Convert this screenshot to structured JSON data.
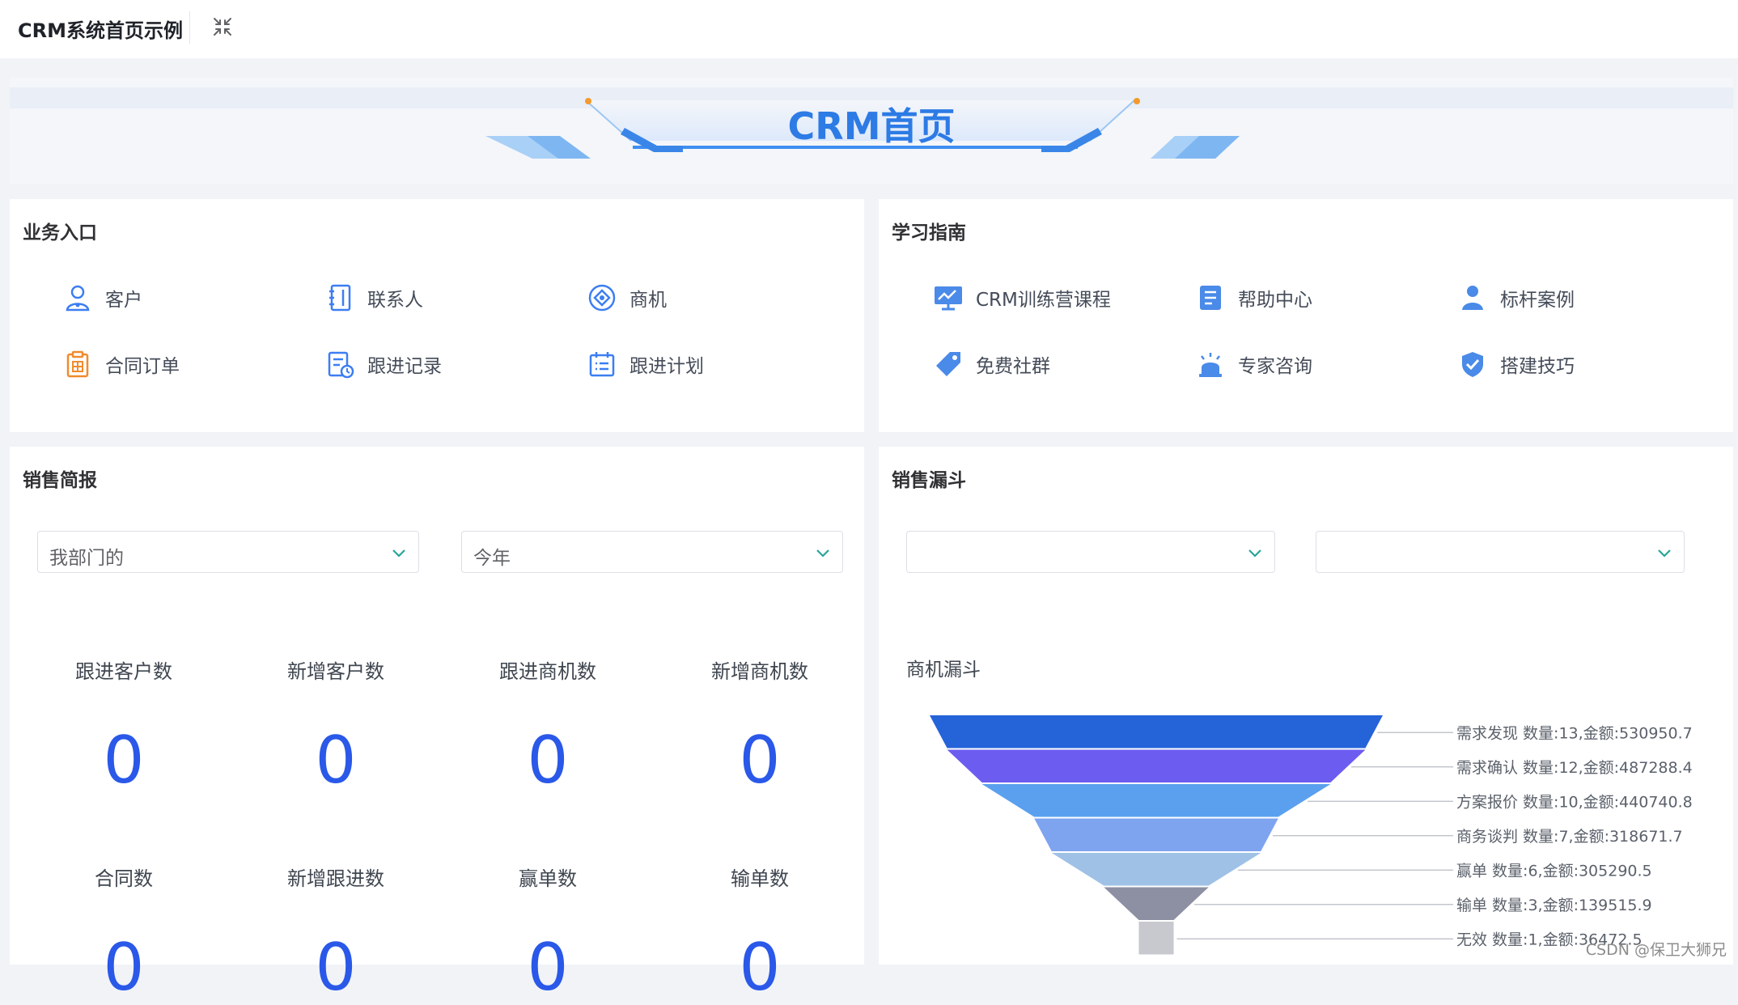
{
  "header": {
    "app_title": "CRM系统首页示例"
  },
  "banner": {
    "title": "CRM首页"
  },
  "business_entry": {
    "title": "业务入口",
    "items": [
      {
        "label": "客户",
        "icon": "user-icon"
      },
      {
        "label": "联系人",
        "icon": "contact-book-icon"
      },
      {
        "label": "商机",
        "icon": "opportunity-icon"
      },
      {
        "label": "合同订单",
        "icon": "contract-icon"
      },
      {
        "label": "跟进记录",
        "icon": "follow-record-icon"
      },
      {
        "label": "跟进计划",
        "icon": "follow-plan-icon"
      }
    ]
  },
  "learning_guide": {
    "title": "学习指南",
    "items": [
      {
        "label": "CRM训练营课程",
        "icon": "training-course-icon"
      },
      {
        "label": "帮助中心",
        "icon": "help-center-icon"
      },
      {
        "label": "标杆案例",
        "icon": "benchmark-case-icon"
      },
      {
        "label": "免费社群",
        "icon": "community-tag-icon"
      },
      {
        "label": "专家咨询",
        "icon": "expert-consult-icon"
      },
      {
        "label": "搭建技巧",
        "icon": "shield-check-icon"
      }
    ]
  },
  "sales_report": {
    "title": "销售简报",
    "scope_select": "我部门的",
    "period_select": "今年",
    "metrics": [
      {
        "label": "跟进客户数",
        "value": "0"
      },
      {
        "label": "新增客户数",
        "value": "0"
      },
      {
        "label": "跟进商机数",
        "value": "0"
      },
      {
        "label": "新增商机数",
        "value": "0"
      },
      {
        "label": "合同数",
        "value": "0"
      },
      {
        "label": "新增跟进数",
        "value": "0"
      },
      {
        "label": "赢单数",
        "value": "0"
      },
      {
        "label": "输单数",
        "value": "0"
      }
    ]
  },
  "sales_funnel": {
    "title": "销售漏斗",
    "select_1": "",
    "select_2": "",
    "chart_title": "商机漏斗"
  },
  "chart_data": {
    "type": "funnel",
    "title": "商机漏斗",
    "stages": [
      {
        "name": "需求发现",
        "count": 13,
        "amount": 530950.7,
        "label": "需求发现 数量:13,金额:530950.7",
        "color": "#2563d9"
      },
      {
        "name": "需求确认",
        "count": 12,
        "amount": 487288.4,
        "label": "需求确认 数量:12,金额:487288.4",
        "color": "#6c5cf0"
      },
      {
        "name": "方案报价",
        "count": 10,
        "amount": 440740.8,
        "label": "方案报价 数量:10,金额:440740.8",
        "color": "#5aa0ee"
      },
      {
        "name": "商务谈判",
        "count": 7,
        "amount": 318671.7,
        "label": "商务谈判 数量:7,金额:318671.7",
        "color": "#7ea4f0"
      },
      {
        "name": "赢单",
        "count": 6,
        "amount": 305290.5,
        "label": "赢单 数量:6,金额:305290.5",
        "color": "#9fc1e6"
      },
      {
        "name": "输单",
        "count": 3,
        "amount": 139515.9,
        "label": "输单 数量:3,金额:139515.9",
        "color": "#8d8fa3"
      },
      {
        "name": "无效",
        "count": 1,
        "amount": 36472.5,
        "label": "无效 数量:1,金额:36472.5",
        "color": "#c7c9cf"
      }
    ]
  },
  "watermark": "CSDN @保卫大狮兄"
}
